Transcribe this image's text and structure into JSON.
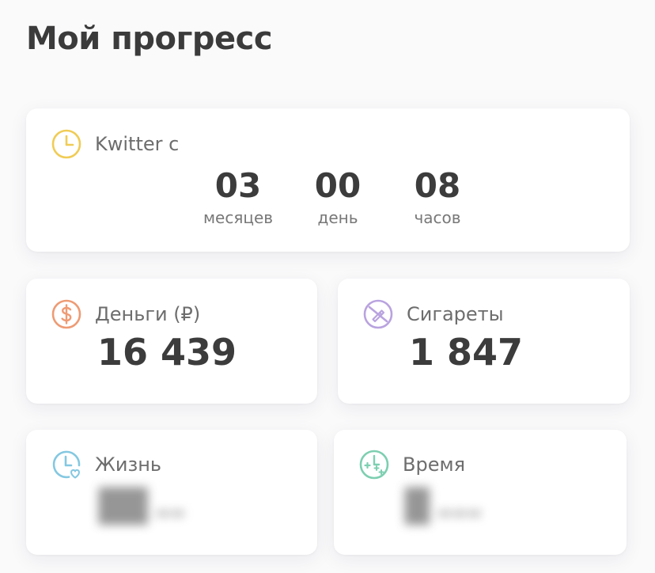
{
  "page": {
    "title": "Мой прогресс"
  },
  "quit_since": {
    "label": "Kwitter с",
    "icon": "clock-icon",
    "units": [
      {
        "value": "03",
        "caption": "месяцев"
      },
      {
        "value": "00",
        "caption": "день"
      },
      {
        "value": "08",
        "caption": "часов"
      }
    ]
  },
  "money": {
    "label": "Деньги (₽)",
    "icon": "dollar-icon",
    "value": "16 439"
  },
  "cigarettes": {
    "label": "Сигареты",
    "icon": "no-cigarette-icon",
    "value": "1 847"
  },
  "life": {
    "label": "Жизнь",
    "icon": "clock-heart-icon",
    "blurred": true
  },
  "time": {
    "label": "Время",
    "icon": "clock-plus-icon",
    "blurred": true
  },
  "colors": {
    "clock_icon": "#f0cc55",
    "dollar_icon": "#ee9b74",
    "cigarette_icon": "#b9a3df",
    "life_icon": "#84c8e1",
    "time_icon": "#7dcfb1",
    "text_dark": "#3c3c3c",
    "text_muted": "#6d6d6d"
  }
}
